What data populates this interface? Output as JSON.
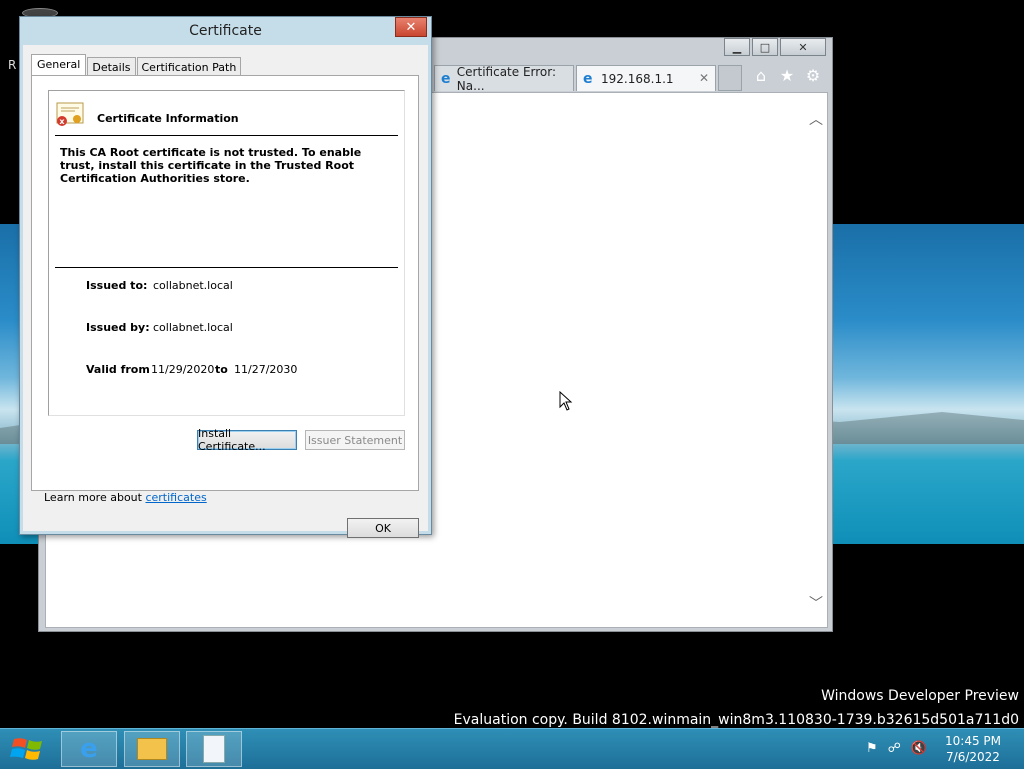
{
  "desktop": {
    "fragment": "R"
  },
  "browser": {
    "tabs": [
      {
        "label": "Certificate Error: Na...",
        "active": false
      },
      {
        "label": "192.168.1.1",
        "active": true
      }
    ],
    "window_buttons": {
      "minimize": "▁",
      "maximize": "□",
      "close": "✕"
    },
    "toolbar_icons": [
      "home-icon",
      "favorites-icon",
      "tools-icon"
    ]
  },
  "dialog": {
    "title": "Certificate",
    "close_glyph": "✕",
    "tabs": [
      "General",
      "Details",
      "Certification Path"
    ],
    "selected_tab": "General",
    "heading": "Certificate Information",
    "message": "This CA Root certificate is not trusted. To enable trust, install this certificate in the Trusted Root Certification Authorities store.",
    "issued_to_label": "Issued to:",
    "issued_to": "collabnet.local",
    "issued_by_label": "Issued by:",
    "issued_by": "collabnet.local",
    "valid_from_label": "Valid from",
    "valid_from": "11/29/2020",
    "to_label": "to",
    "valid_to": "11/27/2030",
    "install_button": "Install Certificate...",
    "issuer_statement_button": "Issuer Statement",
    "learn_more_prefix": "Learn more about ",
    "learn_more_link": "certificates",
    "ok_button": "OK"
  },
  "watermark": {
    "line1": "Windows Developer Preview",
    "line2": "Evaluation copy. Build 8102.winmain_win8m3.110830-1739.b32615d501a711d0"
  },
  "taskbar": {
    "items": [
      "internet-explorer-icon",
      "file-explorer-icon",
      "notepad-icon"
    ],
    "time": "10:45 PM",
    "date": "7/6/2022"
  }
}
